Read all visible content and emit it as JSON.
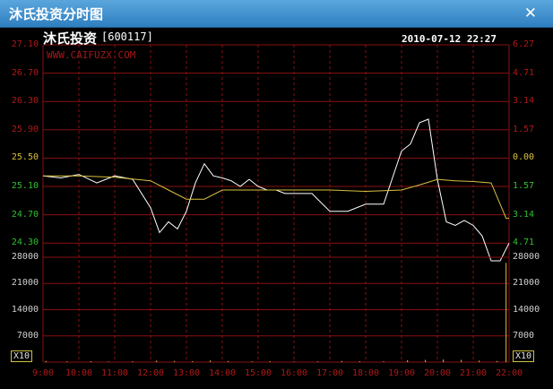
{
  "window": {
    "title": "沐氏投资分时图",
    "close_icon": "close-icon"
  },
  "header": {
    "stock_name": "沐氏投资",
    "stock_code": "[600117]",
    "datetime": "2010-07-12 22:27",
    "watermark": "WWW.CAIFUZX.COM"
  },
  "colors": {
    "price_line": "#ffffff",
    "avg_line": "#d8c040",
    "grid": "#8a1010",
    "up_label": "#b01818",
    "down_label": "#30c030",
    "volume": "#d8c040"
  },
  "chart_data": [
    {
      "type": "line",
      "price_axis_labels": [
        "27.10",
        "26.70",
        "26.30",
        "25.90",
        "25.50",
        "25.10",
        "24.70",
        "24.30"
      ],
      "percent_axis_labels": [
        "6.27",
        "4.71",
        "3.14",
        "1.57",
        "0.00",
        "1.57",
        "3.14",
        "4.71"
      ],
      "reference_price": 25.5,
      "ylim": [
        24.1,
        27.1
      ],
      "x_ticks": [
        "9:00",
        "10:00",
        "11:00",
        "12:00",
        "13:00",
        "14:00",
        "15:00",
        "16:00",
        "17:00",
        "18:00",
        "19:00",
        "20:00",
        "21:00",
        "22:00"
      ],
      "series": [
        {
          "name": "price",
          "x": [
            "9:00",
            "9:30",
            "10:00",
            "10:30",
            "11:00",
            "11:30",
            "12:00",
            "12:15",
            "12:30",
            "12:45",
            "13:00",
            "13:15",
            "13:30",
            "13:45",
            "14:00",
            "14:15",
            "14:30",
            "14:45",
            "15:00",
            "15:15",
            "15:30",
            "15:45",
            "16:00",
            "16:30",
            "17:00",
            "17:30",
            "18:00",
            "18:30",
            "19:00",
            "19:15",
            "19:30",
            "19:45",
            "20:00",
            "20:15",
            "20:30",
            "20:45",
            "21:00",
            "21:15",
            "21:30",
            "21:45",
            "22:00"
          ],
          "values": [
            25.25,
            25.22,
            25.27,
            25.15,
            25.25,
            25.2,
            24.8,
            24.45,
            24.6,
            24.5,
            24.75,
            25.15,
            25.42,
            25.25,
            25.22,
            25.18,
            25.1,
            25.2,
            25.1,
            25.05,
            25.05,
            25.0,
            25.0,
            25.0,
            24.75,
            24.75,
            24.85,
            24.85,
            25.6,
            25.7,
            26.0,
            26.05,
            25.2,
            24.6,
            24.55,
            24.62,
            24.55,
            24.4,
            24.05,
            24.05,
            24.3
          ]
        },
        {
          "name": "average",
          "x": [
            "9:00",
            "10:00",
            "11:00",
            "12:00",
            "12:30",
            "13:00",
            "13:30",
            "14:00",
            "15:00",
            "16:00",
            "17:00",
            "18:00",
            "19:00",
            "19:30",
            "20:00",
            "20:30",
            "21:00",
            "21:30",
            "21:55",
            "22:00"
          ],
          "values": [
            25.25,
            25.25,
            25.23,
            25.18,
            25.05,
            24.92,
            24.92,
            25.05,
            25.05,
            25.05,
            25.05,
            25.03,
            25.05,
            25.12,
            25.2,
            25.18,
            25.17,
            25.15,
            24.65,
            24.65
          ]
        }
      ]
    },
    {
      "type": "bar",
      "axis_labels": [
        "28000",
        "21000",
        "14000",
        "7000"
      ],
      "ylim": [
        0,
        28000
      ],
      "scale_label": "X10",
      "values": [
        {
          "x": "9:05",
          "v": 300
        },
        {
          "x": "9:40",
          "v": 200
        },
        {
          "x": "10:20",
          "v": 250
        },
        {
          "x": "10:50",
          "v": 150
        },
        {
          "x": "11:30",
          "v": 200
        },
        {
          "x": "12:10",
          "v": 400
        },
        {
          "x": "12:40",
          "v": 300
        },
        {
          "x": "13:10",
          "v": 250
        },
        {
          "x": "13:40",
          "v": 450
        },
        {
          "x": "14:10",
          "v": 300
        },
        {
          "x": "14:50",
          "v": 200
        },
        {
          "x": "15:20",
          "v": 250
        },
        {
          "x": "16:00",
          "v": 150
        },
        {
          "x": "16:40",
          "v": 200
        },
        {
          "x": "17:20",
          "v": 300
        },
        {
          "x": "17:50",
          "v": 250
        },
        {
          "x": "18:30",
          "v": 200
        },
        {
          "x": "19:10",
          "v": 500
        },
        {
          "x": "19:40",
          "v": 600
        },
        {
          "x": "20:10",
          "v": 700
        },
        {
          "x": "20:40",
          "v": 600
        },
        {
          "x": "21:10",
          "v": 400
        },
        {
          "x": "21:40",
          "v": 300
        },
        {
          "x": "21:55",
          "v": 26500
        }
      ]
    }
  ]
}
